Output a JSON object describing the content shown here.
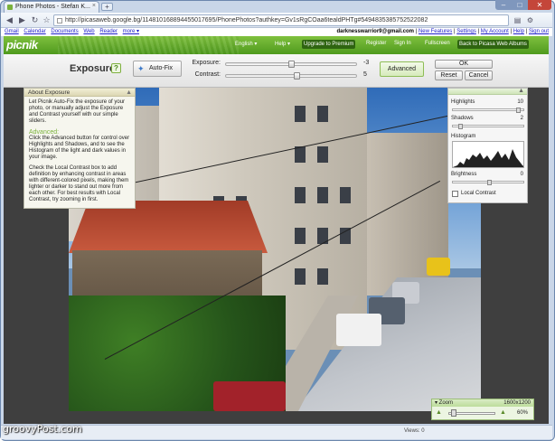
{
  "browser": {
    "tab_title": "Phone Photos - Stefan K...",
    "url": "http://picasaweb.google.bg/114810168894455017695/PhonePhotos?authkey=Gv1sRgCOaa6tealdPHTg#5494835385752522082",
    "newtab_glyph": "+",
    "google_bar_left": [
      "Gmail",
      "Calendar",
      "Documents",
      "Web",
      "Reader",
      "more ▾"
    ],
    "google_bar_user": "darknesswarrior9@gmail.com",
    "google_bar_links": [
      "New Features",
      "Settings",
      "My Account",
      "Help",
      "Sign out"
    ]
  },
  "picnik": {
    "logo": "picnik",
    "nav": [
      "English ▾",
      "Help ▾",
      "Upgrade to Premium",
      "Register",
      "Sign In",
      "Fullscreen",
      "Back to Picasa Web Albums"
    ]
  },
  "controls": {
    "title": "Exposure",
    "help_label": "?",
    "autofix_label": "Auto-Fix",
    "exposure_label": "Exposure:",
    "exposure_value": "-3",
    "exposure_position": 0.5,
    "contrast_label": "Contrast:",
    "contrast_value": "5",
    "contrast_position": 0.55,
    "advanced_label": "Advanced",
    "ok_label": "OK",
    "reset_label": "Reset",
    "cancel_label": "Cancel"
  },
  "about": {
    "title": "About Exposure",
    "close_glyph": "▲",
    "p1": "Let Picnik Auto-Fix the exposure of your photo, or manually adjust the Exposure and Contrast yourself with our simple sliders.",
    "advanced_heading": "Advanced:",
    "p2": "Click the Advanced button for control over Highlights and Shadows, and to see the Histogram of the light and dark values in your image.",
    "p3": "Check the Local Contrast box to add definition by enhancing contrast in areas with different-colored pixels, making them lighter or darker to stand out more from each other. For best results with Local Contrast, try zooming in first."
  },
  "advanced": {
    "highlights_label": "Highlights",
    "highlights_value": "10",
    "shadows_label": "Shadows",
    "shadows_value": "2",
    "histogram_label": "Histogram",
    "brightness_label": "Brightness",
    "brightness_value": "0",
    "local_contrast_label": "Local Contrast",
    "collapse_glyph": "▲"
  },
  "zoom": {
    "label": "▾ Zoom",
    "dimensions": "1600x1200",
    "percent": "60%"
  },
  "status": {
    "views": "Views: 0"
  },
  "watermark": "groovyPost.com"
}
